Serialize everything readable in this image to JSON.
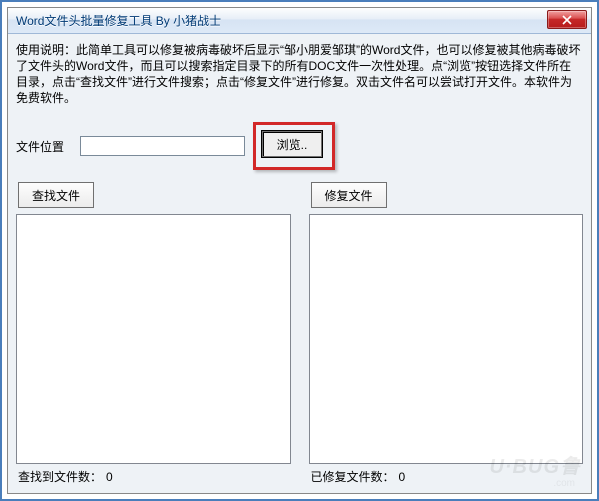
{
  "window": {
    "title": "Word文件头批量修复工具  By 小猪战士"
  },
  "instructions": {
    "text": "使用说明：此简单工具可以修复被病毒破坏后显示“邹小朋爱邹琪”的Word文件，也可以修复被其他病毒破坏了文件头的Word文件，而且可以搜索指定目录下的所有DOC文件一次性处理。点“浏览”按钮选择文件所在目录，点击“查找文件”进行文件搜索；点击“修复文件”进行修复。双击文件名可以尝试打开文件。本软件为免费软件。"
  },
  "path": {
    "label": "文件位置",
    "value": "",
    "browse_label": "浏览.."
  },
  "left": {
    "button_label": "查找文件",
    "status_label": "查找到文件数：",
    "status_value": "0"
  },
  "right": {
    "button_label": "修复文件",
    "status_label": "已修复文件数：",
    "status_value": "0"
  },
  "watermark": {
    "main": "U·BUG鲁",
    "sub": ".com"
  }
}
